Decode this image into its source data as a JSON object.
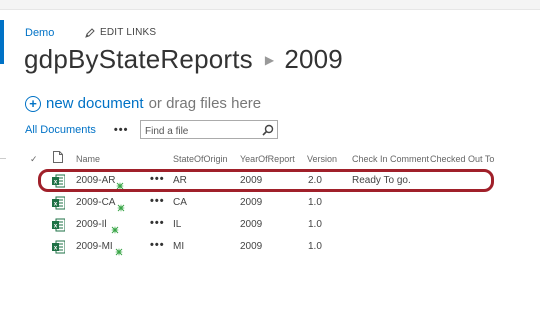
{
  "breadcrumb": {
    "site_link": "Demo",
    "edit_links": "EDIT LINKS"
  },
  "title": {
    "library": "gdpByStateReports",
    "folder": "2009"
  },
  "new_document": {
    "link": "new document",
    "rest": "or drag files here"
  },
  "views": {
    "current": "All Documents",
    "more": "•••"
  },
  "search": {
    "placeholder": "Find a file"
  },
  "columns": {
    "check": "✓",
    "name": "Name",
    "state": "StateOfOrigin",
    "year": "YearOfReport",
    "version": "Version",
    "comment": "Check In Comment",
    "checked_out": "Checked Out To"
  },
  "rows": [
    {
      "name": "2009-AR",
      "state": "AR",
      "year": "2009",
      "version": "2.0",
      "comment": "Ready To go.",
      "checked_out": ""
    },
    {
      "name": "2009-CA",
      "state": "CA",
      "year": "2009",
      "version": "1.0",
      "comment": "",
      "checked_out": ""
    },
    {
      "name": "2009-Il",
      "state": "IL",
      "year": "2009",
      "version": "1.0",
      "comment": "",
      "checked_out": ""
    },
    {
      "name": "2009-MI",
      "state": "MI",
      "year": "2009",
      "version": "1.0",
      "comment": "",
      "checked_out": ""
    }
  ],
  "row_menu": "•••",
  "icons": {
    "file_type": "excel-file-icon",
    "new_item": "new-item-icon",
    "search": "search-icon",
    "edit": "pencil-icon",
    "add": "add-circle-icon"
  },
  "colors": {
    "accent": "#0072c6",
    "highlight": "#a0202a",
    "excel": "#1e7145",
    "new_item": "#3aa648"
  }
}
